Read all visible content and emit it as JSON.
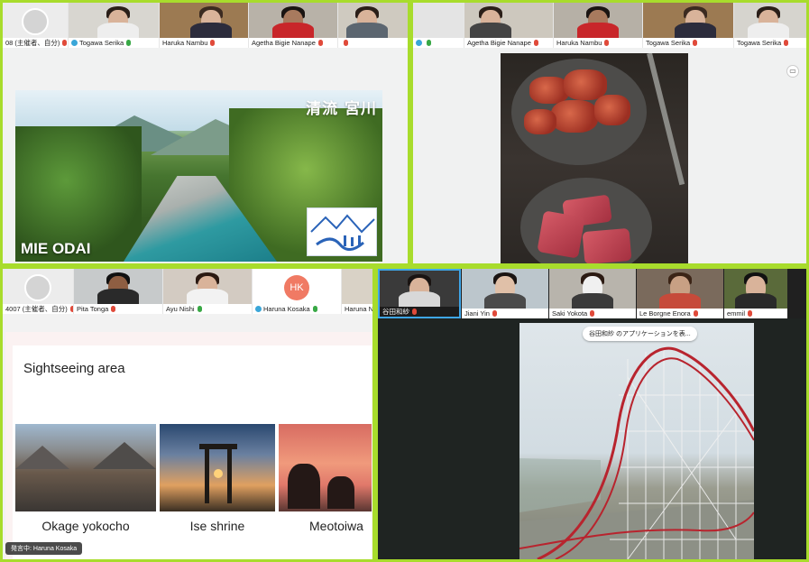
{
  "panel1": {
    "participants": [
      {
        "name": "08 (主催者、自分)",
        "mic": "muted",
        "kind": "avatar"
      },
      {
        "name": "Togawa Serika",
        "mic": "on",
        "kind": "video",
        "shield": true
      },
      {
        "name": "Haruka Nambu",
        "mic": "muted",
        "kind": "video"
      },
      {
        "name": "Agetha Bigie Nanape",
        "mic": "muted",
        "kind": "video"
      },
      {
        "name": "",
        "mic": "muted",
        "kind": "video"
      }
    ],
    "slide": {
      "title": "清流 宮川",
      "caption": "MIE ODAI"
    }
  },
  "panel2": {
    "participants": [
      {
        "name": "",
        "mic": "on",
        "kind": "video",
        "shield": true
      },
      {
        "name": "Agetha Bigie Nanape",
        "mic": "muted",
        "kind": "video"
      },
      {
        "name": "Haruka Nambu",
        "mic": "muted",
        "kind": "video"
      },
      {
        "name": "Togawa Serika",
        "mic": "muted",
        "kind": "video"
      }
    ]
  },
  "panel3": {
    "participants": [
      {
        "name": "4007 (主催者、自分)",
        "mic": "muted",
        "kind": "avatar"
      },
      {
        "name": "Pita Tonga",
        "mic": "muted",
        "kind": "video"
      },
      {
        "name": "Ayu Nishi",
        "mic": "on",
        "kind": "video"
      },
      {
        "name": "Haruna Kosaka",
        "mic": "on",
        "kind": "initials",
        "initials": "HK",
        "shield": true
      },
      {
        "name": "Haruna N",
        "mic": "muted",
        "kind": "video"
      }
    ],
    "slide": {
      "title": "Sightseeing area",
      "places": [
        "Okage yokocho",
        "Ise shrine",
        "Meotoiwa"
      ]
    },
    "speaking": "発言中: Haruna Kosaka"
  },
  "panel4": {
    "participants": [
      {
        "name": "谷田和紗",
        "mic": "muted",
        "kind": "video",
        "active": true
      },
      {
        "name": "Jiani Yin",
        "mic": "muted",
        "kind": "video"
      },
      {
        "name": "Saki Yokota",
        "mic": "muted",
        "kind": "video"
      },
      {
        "name": "Le Borgne Enora",
        "mic": "muted",
        "kind": "video"
      },
      {
        "name": "emmil",
        "mic": "muted",
        "kind": "video"
      }
    ],
    "share_tag": "谷田和紗 のアプリケーションを表..."
  },
  "colors": {
    "panel_border": "#a8dc2c",
    "mic_muted": "#e04a3a",
    "mic_on": "#38a845",
    "hk_avatar": "#f07a64"
  }
}
